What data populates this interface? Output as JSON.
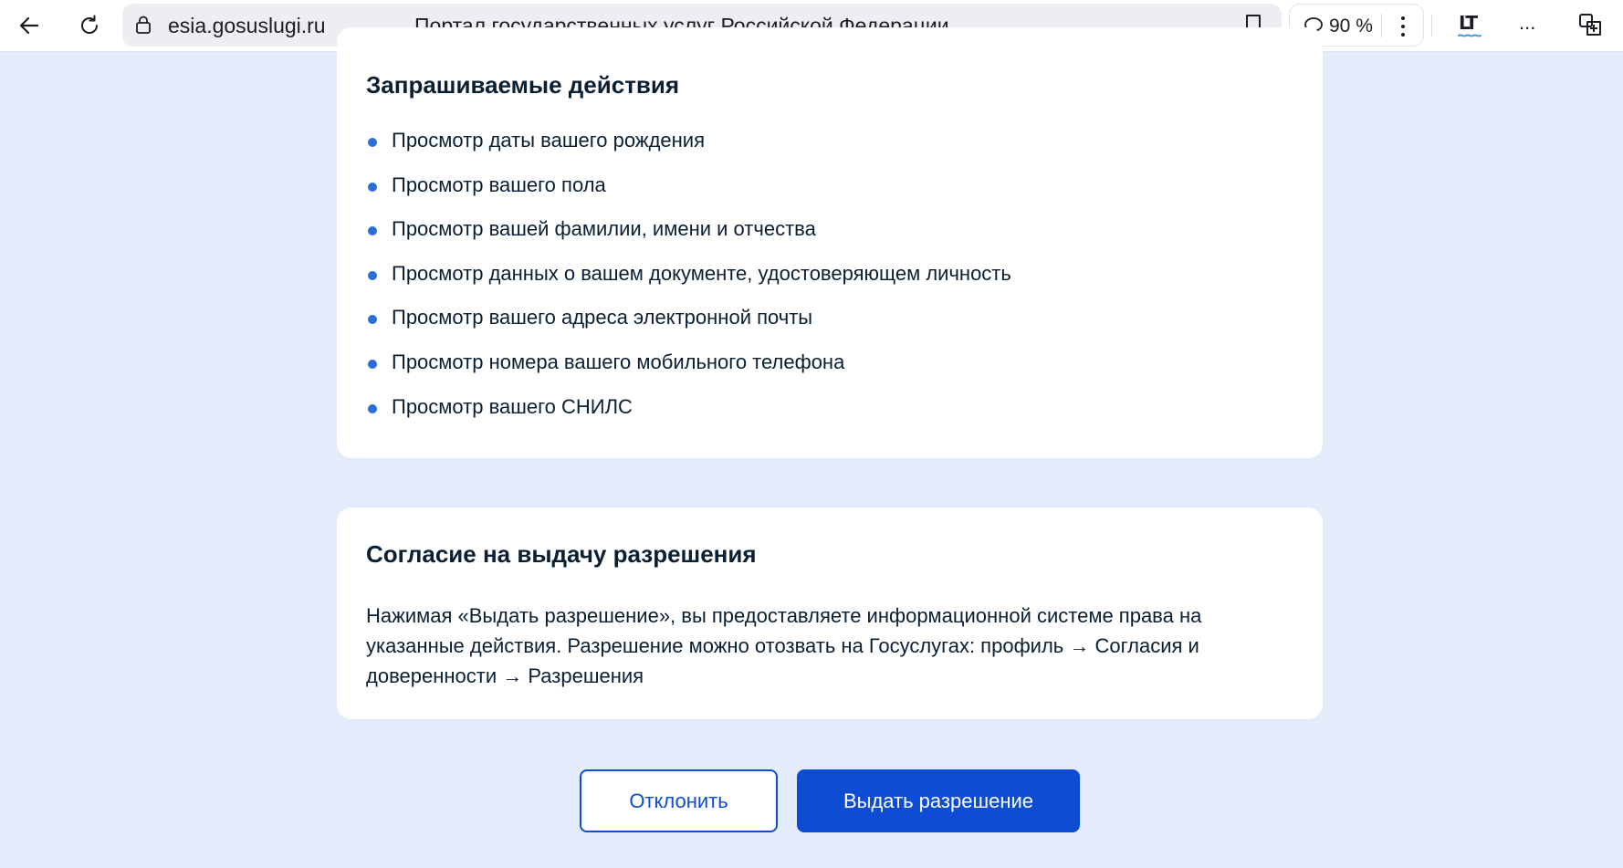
{
  "browser": {
    "url": "esia.gosuslugi.ru",
    "page_title": "Портал государственных услуг Российской Федерации",
    "zoom": "90 %",
    "more_label": "...",
    "lt_label": "LT",
    "icons": [
      "back-arrow-icon",
      "reload-icon",
      "lock-icon",
      "bookmark-icon",
      "chat-bubble-icon",
      "kebab-menu-icon",
      "lt-extension-icon",
      "extensions-icon"
    ]
  },
  "requested_actions": {
    "title": "Запрашиваемые действия",
    "items": [
      {
        "label": "Просмотр даты вашего рождения"
      },
      {
        "label": "Просмотр вашего пола"
      },
      {
        "label": "Просмотр вашей фамилии, имени и отчества"
      },
      {
        "label": "Просмотр данных о вашем документе, удостоверяющем личность"
      },
      {
        "label": "Просмотр вашего адреса электронной почты"
      },
      {
        "label": "Просмотр номера вашего мобильного телефона"
      },
      {
        "label": "Просмотр вашего СНИЛС"
      }
    ]
  },
  "consent": {
    "title": "Согласие на выдачу разрешения",
    "text": "Нажимая «Выдать разрешение», вы предоставляете информационной системе права на указанные действия. Разрешение можно отозвать на Госуслугах: профиль → Согласия и доверенности → Разрешения"
  },
  "buttons": {
    "reject_label": "Отклонить",
    "allow_label": "Выдать разрешение"
  },
  "colors": {
    "page_background": "#e4ebfa",
    "card_background": "#ffffff",
    "primary": "#0d4cd3",
    "bullet": "#2b6ed8",
    "text": "#0b1f33"
  }
}
